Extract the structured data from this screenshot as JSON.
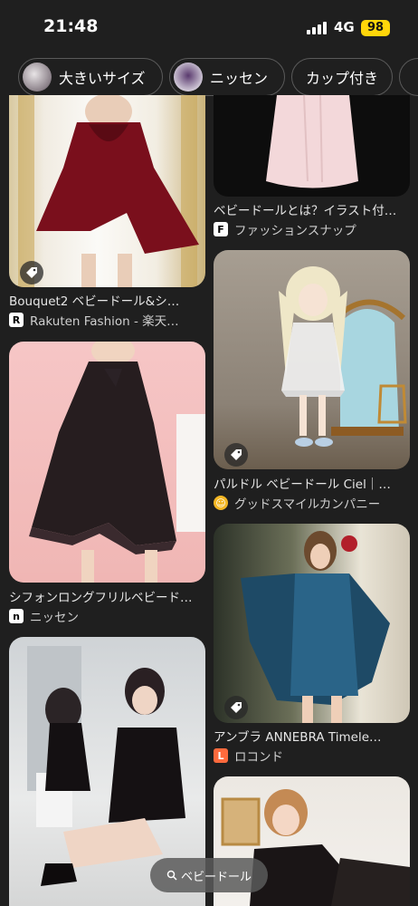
{
  "status_bar": {
    "time": "21:48",
    "network": "4G",
    "battery": "98"
  },
  "chips": [
    {
      "label": "大きいサイズ"
    },
    {
      "label": "ニッセン"
    },
    {
      "label": "カップ付き"
    }
  ],
  "left_column": [
    {
      "title": "Bouquet2 ベビードール&シ…",
      "source": "Rakuten Fashion - 楽天…",
      "favicon": "R"
    },
    {
      "title": "シフォンロングフリルベビード…",
      "source": "ニッセン",
      "favicon": "n"
    },
    {
      "title": "",
      "source": "",
      "favicon": ""
    }
  ],
  "right_column": [
    {
      "title": "ベビードールとは？イラスト付…",
      "source": "ファッションスナップ",
      "favicon": "F"
    },
    {
      "title": "パルドル ベビードール Ciel｜…",
      "source": "グッドスマイルカンパニー",
      "favicon": "☺"
    },
    {
      "title": "アンブラ ANNEBRA Timele…",
      "source": "ロコンド",
      "favicon": "L"
    }
  ],
  "search_pill": {
    "label": "ベビードール"
  },
  "colors": {
    "background": "#1f1f1f",
    "battery": "#ffd60a",
    "locondo": "#ff6a3d",
    "goodsmile": "#f3b623"
  }
}
